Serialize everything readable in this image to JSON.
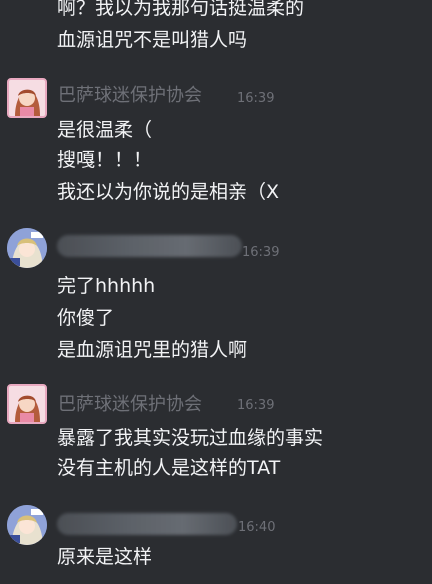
{
  "top_messages": [
    "啊？我以为我那句话挺温柔的",
    "血源诅咒不是叫猎人吗"
  ],
  "messages": [
    {
      "author": "巴萨球迷保护协会",
      "time": "16:39",
      "avatar": "pink-anime-avatar",
      "lines": [
        "是很温柔（",
        "搜嘎！！！",
        "我还以为你说的是相亲（X"
      ]
    },
    {
      "author": "",
      "author_redacted": true,
      "time": "16:39",
      "avatar": "blue-anime-avatar",
      "lines": [
        "完了hhhhh",
        "你傻了",
        "是血源诅咒里的猎人啊"
      ]
    },
    {
      "author": "巴萨球迷保护协会",
      "time": "16:39",
      "avatar": "pink-anime-avatar",
      "lines": [
        "暴露了我其实没玩过血缘的事实",
        "没有主机的人是这样的TAT"
      ]
    },
    {
      "author": "",
      "author_redacted": true,
      "time": "16:40",
      "avatar": "blue-anime-avatar",
      "lines": [
        "原来是这样"
      ]
    }
  ],
  "colors": {
    "background": "#2b2d31",
    "text": "#f2f3f5",
    "muted": "#6e7077"
  }
}
